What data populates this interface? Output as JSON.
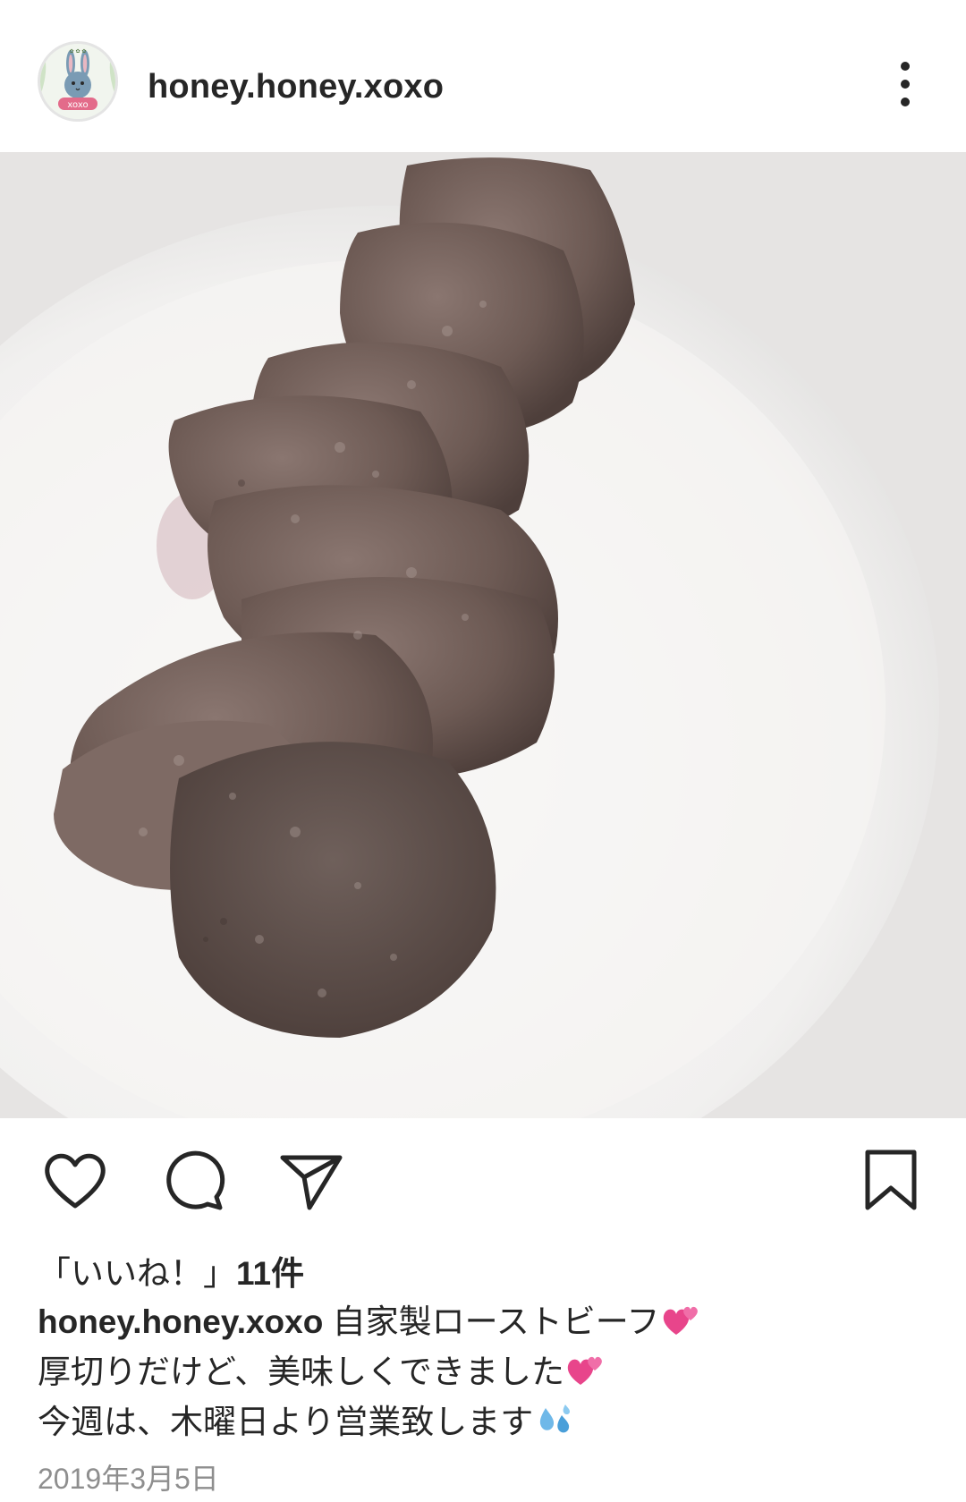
{
  "header": {
    "username": "honey.honey.xoxo",
    "avatar_icon": "bunny-avatar-icon",
    "avatar_text": "xoxo",
    "more_icon": "more-vertical-icon"
  },
  "post": {
    "image_alt": "roast beef slices on white plate",
    "colors": {
      "plate": "#f7f6f5",
      "background": "#e9e7e6",
      "meat": "#6b5650"
    }
  },
  "actions": {
    "like_icon": "heart-icon",
    "comment_icon": "comment-icon",
    "share_icon": "send-icon",
    "save_icon": "bookmark-icon"
  },
  "likes": {
    "prefix": "「いいね！」",
    "count": "11件"
  },
  "caption": {
    "username": "honey.honey.xoxo",
    "line1": " 自家製ローストビーフ",
    "line2": "厚切りだけど、美味しくできました",
    "line3": "今週は、木曜日より営業致します",
    "emoji1": "two-hearts-icon",
    "emoji2": "two-hearts-icon",
    "emoji3": "sweat-droplets-icon"
  },
  "date": "2019年3月5日"
}
